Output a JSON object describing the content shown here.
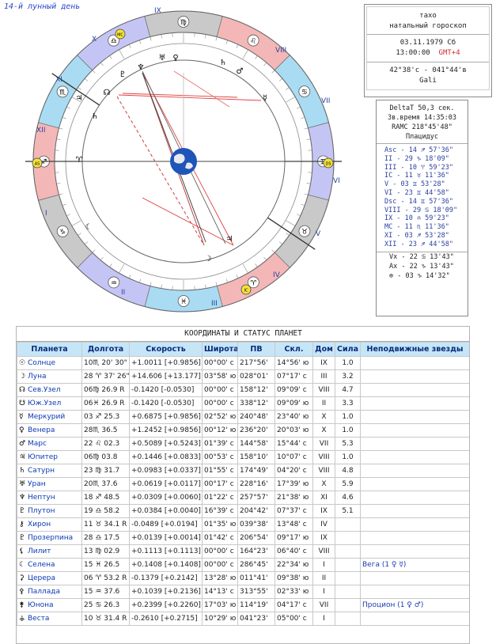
{
  "lunar_day": "14-й лунный день",
  "info": {
    "name": "тахо",
    "subtitle": "натальный гороскоп",
    "date": "03.11.1979 Сб",
    "time": "13:00:00",
    "gmt": "GMT+4",
    "coords": "42°38'с - 041°44'в",
    "place": "Gali"
  },
  "houses_box": {
    "delta": "DeltaT  50,3 сек.",
    "stime": "Зв.время 14:35:03",
    "ramc": "RAMC 218°45'48\"",
    "system": "Плацидус",
    "cusps": [
      "Asc - 14 ♐ 57'36\"",
      "II - 29 ♑ 18'09\"",
      "III - 10 ♈ 59'23\"",
      "IC - 11 ♉ 11'36\"",
      "V - 03 ♊ 53'28\"",
      "VI - 23 ♊ 44'58\"",
      "Dsc - 14 ♊ 57'36\"",
      "VIII - 29 ♋ 18'09\"",
      "IX - 10 ♎ 59'23\"",
      "MC - 11 ♏ 11'36\"",
      "XI - 03 ♐ 53'28\"",
      "XII - 23 ♐ 44'58\""
    ],
    "points": [
      "Vx - 22 ♋ 13'43\"",
      "Ax - 22 ♑ 13'43\"",
      "⊗ - 03 ♑ 14'32\""
    ]
  },
  "house_numerals": [
    "I",
    "II",
    "III",
    "IV",
    "V",
    "VI",
    "VII",
    "VIII",
    "IX",
    "X",
    "XI",
    "XII"
  ],
  "table": {
    "caption": "КООРДИНАТЫ И СТАТУС ПЛАНЕТ",
    "headers": [
      "Планета",
      "Долгота",
      "Скорость",
      "Широта",
      "ПВ",
      "Скл.",
      "Дом",
      "Сила",
      "Неподвижные звезды"
    ],
    "rows": [
      {
        "glyph": "☉",
        "name": "Солнце",
        "lon": "10♏ 20' 30\"",
        "speed": "+1.0011 [+0.9856]",
        "lat": "00°00' с",
        "pv": "217°56'",
        "decl": "14°56' ю",
        "house": "IX",
        "power": "1.0",
        "star": ""
      },
      {
        "glyph": "☽",
        "name": "Луна",
        "lon": "28 ♈ 37' 26\"",
        "speed": "+14.606 [+13.177]",
        "lat": "03°58' ю",
        "pv": "028°01'",
        "decl": "07°17' с",
        "house": "III",
        "power": "3.2",
        "star": ""
      },
      {
        "glyph": "☊",
        "name": "Сев.Узел",
        "lon": "06♍ 26.9 R",
        "speed": "-0.1420 [-0.0530]",
        "lat": "00°00' с",
        "pv": "158°12'",
        "decl": "09°09' с",
        "house": "VIII",
        "power": "4.7",
        "star": ""
      },
      {
        "glyph": "☋",
        "name": "Юж.Узел",
        "lon": "06♓ 26.9 R",
        "speed": "-0.1420 [-0.0530]",
        "lat": "00°00' с",
        "pv": "338°12'",
        "decl": "09°09' ю",
        "house": "II",
        "power": "3.3",
        "star": ""
      },
      {
        "glyph": "☿",
        "name": "Меркурий",
        "lon": "03 ♐ 25.3",
        "speed": "+0.6875 [+0.9856]",
        "lat": "02°52' ю",
        "pv": "240°48'",
        "decl": "23°40' ю",
        "house": "X",
        "power": "1.0",
        "star": ""
      },
      {
        "glyph": "♀",
        "name": "Венера",
        "lon": "28♏ 36.5",
        "speed": "+1.2452 [+0.9856]",
        "lat": "00°12' ю",
        "pv": "236°20'",
        "decl": "20°03' ю",
        "house": "X",
        "power": "1.0",
        "star": ""
      },
      {
        "glyph": "♂",
        "name": "Марс",
        "lon": "22 ♌ 02.3",
        "speed": "+0.5089 [+0.5243]",
        "lat": "01°39' с",
        "pv": "144°58'",
        "decl": "15°44' с",
        "house": "VII",
        "power": "5.3",
        "star": ""
      },
      {
        "glyph": "♃",
        "name": "Юпитер",
        "lon": "06♍ 03.8",
        "speed": "+0.1446 [+0.0833]",
        "lat": "00°53' с",
        "pv": "158°10'",
        "decl": "10°07' с",
        "house": "VIII",
        "power": "1.0",
        "star": ""
      },
      {
        "glyph": "♄",
        "name": "Сатурн",
        "lon": "23 ♍ 31.7",
        "speed": "+0.0983 [+0.0337]",
        "lat": "01°55' с",
        "pv": "174°49'",
        "decl": "04°20' с",
        "house": "VIII",
        "power": "4.8",
        "star": ""
      },
      {
        "glyph": "♅",
        "name": "Уран",
        "lon": "20♏ 37.6",
        "speed": "+0.0619 [+0.0117]",
        "lat": "00°17' с",
        "pv": "228°16'",
        "decl": "17°39' ю",
        "house": "X",
        "power": "5.9",
        "star": ""
      },
      {
        "glyph": "♆",
        "name": "Нептун",
        "lon": "18 ♐ 48.5",
        "speed": "+0.0309 [+0.0060]",
        "lat": "01°22' с",
        "pv": "257°57'",
        "decl": "21°38' ю",
        "house": "XI",
        "power": "4.6",
        "star": ""
      },
      {
        "glyph": "♇",
        "name": "Плутон",
        "lon": "19 ♎ 58.2",
        "speed": "+0.0384 [+0.0040]",
        "lat": "16°39' с",
        "pv": "204°42'",
        "decl": "07°37' с",
        "house": "IX",
        "power": "5.1",
        "star": ""
      },
      {
        "glyph": "⚷",
        "name": "Хирон",
        "lon": "11 ♉ 34.1 R",
        "speed": "-0.0489 [+0.0194]",
        "lat": "01°35' ю",
        "pv": "039°38'",
        "decl": "13°48' с",
        "house": "IV",
        "power": "",
        "star": ""
      },
      {
        "glyph": "♇",
        "name": "Прозерпина",
        "lon": "28 ♎ 17.5",
        "speed": "+0.0139 [+0.0014]",
        "lat": "01°42' с",
        "pv": "206°54'",
        "decl": "09°17' ю",
        "house": "IX",
        "power": "",
        "star": ""
      },
      {
        "glyph": "⚸",
        "name": "Лилит",
        "lon": "13 ♍ 02.9",
        "speed": "+0.1113 [+0.1113]",
        "lat": "00°00' с",
        "pv": "164°23'",
        "decl": "06°40' с",
        "house": "VIII",
        "power": "",
        "star": ""
      },
      {
        "glyph": "☾",
        "name": "Селена",
        "lon": "15 ♓ 26.5",
        "speed": "+0.1408 [+0.1408]",
        "lat": "00°00' с",
        "pv": "286°45'",
        "decl": "22°34' ю",
        "house": "I",
        "power": "",
        "star": "Вега (1 ♀ ☿)"
      },
      {
        "glyph": "⚳",
        "name": "Церера",
        "lon": "06 ♈ 53.2 R",
        "speed": "-0.1379 [+0.2142]",
        "lat": "13°28' ю",
        "pv": "011°41'",
        "decl": "09°38' ю",
        "house": "II",
        "power": "",
        "star": ""
      },
      {
        "glyph": "⚴",
        "name": "Паллада",
        "lon": "15 ♒ 37.6",
        "speed": "+0.1039 [+0.2136]",
        "lat": "14°13' с",
        "pv": "313°55'",
        "decl": "02°33' ю",
        "house": "I",
        "power": "",
        "star": ""
      },
      {
        "glyph": "⚵",
        "name": "Юнона",
        "lon": "25 ♋ 26.3",
        "speed": "+0.2399 [+0.2260]",
        "lat": "17°03' ю",
        "pv": "114°19'",
        "decl": "04°17' с",
        "house": "VII",
        "power": "",
        "star": "Процион (1 ♀ ♂)"
      },
      {
        "glyph": "⚶",
        "name": "Веста",
        "lon": "10 ♉ 31.4 R",
        "speed": "-0.2610 [+0.2715]",
        "lat": "10°29' ю",
        "pv": "041°23'",
        "decl": "05°00' с",
        "house": "I",
        "power": "",
        "star": ""
      }
    ]
  },
  "colors": {
    "fire": "#f4b7b7",
    "earth": "#c9c9c9",
    "air": "#c5c5f5",
    "water": "#a9dcf2",
    "accent": "#2a47c8",
    "header": "#c6e6f8"
  }
}
